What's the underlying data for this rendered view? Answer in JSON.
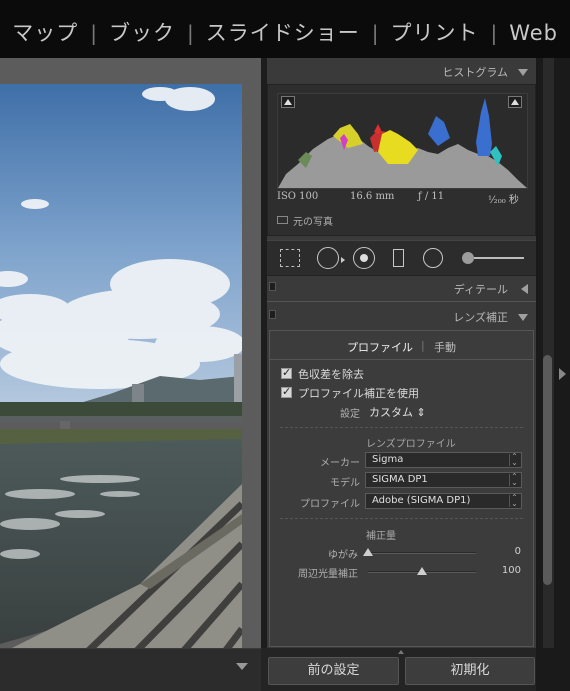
{
  "module_bar": {
    "modules": [
      "マップ",
      "ブック",
      "スライドショー",
      "プリント",
      "Web"
    ]
  },
  "histogram": {
    "title": "ヒストグラム",
    "iso": "ISO 100",
    "focal_length": "16.6 mm",
    "aperture": "ƒ / 11",
    "shutter": "¹⁄₂₀₀ 秒",
    "original_photo_label": "元の写真"
  },
  "detail": {
    "title": "ディテール"
  },
  "lens": {
    "title": "レンズ補正",
    "tabs": [
      "プロファイル",
      "手動"
    ],
    "remove_ca_label": "色収差を除去",
    "enable_profile_label": "プロファイル補正を使用",
    "setup_label": "設定",
    "setup_value": "カスタム ⇕",
    "lens_profile_heading": "レンズプロファイル",
    "make_label": "メーカー",
    "make_value": "Sigma",
    "model_label": "モデル",
    "model_value": "SIGMA DP1",
    "profile_label": "プロファイル",
    "profile_value": "Adobe (SIGMA DP1)",
    "amount_heading": "補正量",
    "distortion_label": "ゆがみ",
    "distortion_value": "0",
    "vignetting_label": "周辺光量補正",
    "vignetting_value": "100",
    "distortion_level": 0,
    "vignetting_level": 100
  },
  "buttons": {
    "previous": "前の設定",
    "reset": "初期化"
  },
  "icons": [
    "crop-icon",
    "spot-removal-icon",
    "red-eye-icon",
    "graduated-filter-icon",
    "radial-filter-icon",
    "adjustment-brush-icon"
  ]
}
